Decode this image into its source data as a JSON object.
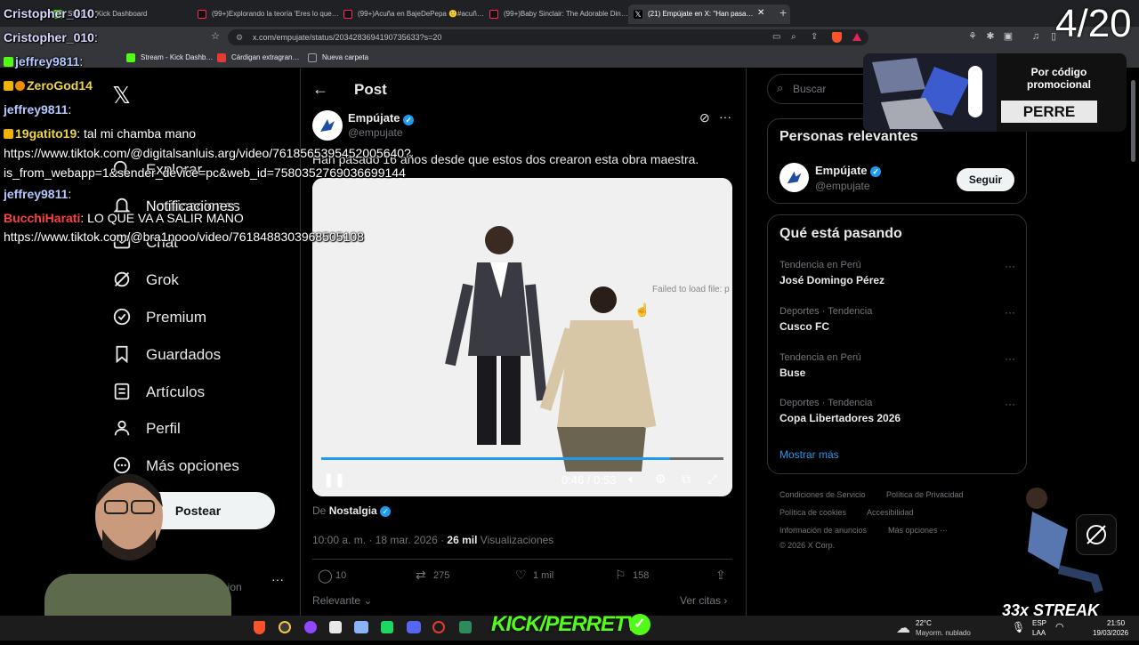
{
  "browser": {
    "tabs": [
      {
        "label": "Stream - Kick Dashboard",
        "color": "#53fc18"
      },
      {
        "label": "(99+)Explorando la teoría 'Eres lo que…",
        "color": "#fe2c55"
      },
      {
        "label": "(99+)Acuña en BajeDePepa 🙂#acuñ…",
        "color": "#fe2c55"
      },
      {
        "label": "(99+)Baby Sinclair: The Adorable Din…",
        "color": "#fe2c55"
      },
      {
        "label": "(21) Empújate en X: \"Han pasa…",
        "color": "#ffffff"
      }
    ],
    "url": "x.com/empujate/status/2034283694190735633?s=20",
    "bookmarks": [
      {
        "label": "Stream - Kick Dashb…",
        "color": "#53fc18"
      },
      {
        "label": "Cárdigan extragran…",
        "color": "#e53935"
      },
      {
        "label": "Nueva carpeta",
        "color": "#9aa0a6"
      }
    ]
  },
  "nav": {
    "items": [
      {
        "label": "Explorar",
        "icon": "search-icon"
      },
      {
        "label": "Notificaciones",
        "icon": "bell-icon"
      },
      {
        "label": "Chat",
        "icon": "mail-icon"
      },
      {
        "label": "Grok",
        "icon": "grok-icon"
      },
      {
        "label": "Premium",
        "icon": "verified-icon"
      },
      {
        "label": "Guardados",
        "icon": "bookmark-icon"
      },
      {
        "label": "Artículos",
        "icon": "article-icon"
      },
      {
        "label": "Perfil",
        "icon": "person-icon"
      },
      {
        "label": "Más opciones",
        "icon": "more-icon"
      }
    ],
    "post_label": "Postear",
    "profile_partial": "…ision"
  },
  "post": {
    "header_title": "Post",
    "author_name": "Empújate",
    "author_handle": "@empujate",
    "text": "Han pasado 16 años desde que estos dos crearon esta obra maestra.",
    "video_time": "0:46 / 0:53",
    "video_progress": 0.868,
    "video_overlay": "Failed to load file: p",
    "source_prefix": "De",
    "source_name": "Nostalgia",
    "timestamp": "10:00 a. m. · 18 mar. 2026 ·",
    "views_count": "26 mil",
    "views_label": "Visualizaciones",
    "replies": "10",
    "reposts": "275",
    "likes": "1 mil",
    "bookmarks": "158",
    "sort_label": "Relevante",
    "quotes_label": "Ver citas"
  },
  "sidebar": {
    "search_placeholder": "Buscar",
    "relevant_title": "Personas relevantes",
    "relevant_name": "Empújate",
    "relevant_handle": "@empujate",
    "follow_label": "Seguir",
    "trends_title": "Qué está pasando",
    "trends": [
      {
        "category": "Tendencia en Perú",
        "name": "José Domingo Pérez"
      },
      {
        "category": "Deportes · Tendencia",
        "name": "Cusco FC"
      },
      {
        "category": "Tendencia en Perú",
        "name": "Buse"
      },
      {
        "category": "Deportes · Tendencia",
        "name": "Copa Libertadores 2026"
      }
    ],
    "show_more": "Mostrar más",
    "footer": [
      "Condiciones de Servicio",
      "Política de Privacidad",
      "Política de cookies",
      "Accesibilidad",
      "Información de anuncios",
      "Más opciones ···",
      "© 2026 X Corp."
    ]
  },
  "overlay": {
    "counter": "4/20",
    "promo_line1": "Por código",
    "promo_line2": "promocional",
    "promo_code": "PERRE",
    "streak": "33x STREAK",
    "kick_brand": "KICK/PERRETV",
    "chat": [
      {
        "user": "Cristopher_010",
        "msg": ":",
        "color": "#d9d9ff"
      },
      {
        "user": "Cristopher_010",
        "msg": ":",
        "color": "#d9d9ff"
      },
      {
        "user": "jeffrey9811",
        "msg": ":",
        "color": "#b4c8ff"
      },
      {
        "user": "ZeroGod14",
        "msg": "",
        "color": "#f0d640"
      },
      {
        "user": "jeffrey9811",
        "msg": ":",
        "color": "#b4c8ff"
      },
      {
        "user": "19gatito19",
        "msg": ": tal mi chamba mano",
        "color": "#f0d640"
      },
      {
        "user": "",
        "msg": "https://www.tiktok.com/@digitalsanluis.arg/video/7618565395452005640?",
        "color": "#ffffff"
      },
      {
        "user": "",
        "msg": "is_from_webapp=1&sender_device=pc&web_id=7580352769036699144",
        "color": "#ffffff"
      },
      {
        "user": "jeffrey9811",
        "msg": ":",
        "color": "#b4c8ff"
      },
      {
        "user": "",
        "msg": "Notificaciones",
        "color": "#ffffff"
      },
      {
        "user": "BucchiHarati",
        "msg": ": LO QUE VA A SALIR MANO",
        "color": "#ff4040"
      },
      {
        "user": "",
        "msg": "https://www.tiktok.com/@bra1nooo/video/7618488303968505108",
        "color": "#ffffff"
      }
    ]
  },
  "taskbar": {
    "weather_temp": "22°C",
    "weather_desc": "Mayorm. nublado",
    "lang1": "ESP",
    "lang2": "LAA",
    "time": "21:50",
    "date": "19/03/2026"
  }
}
